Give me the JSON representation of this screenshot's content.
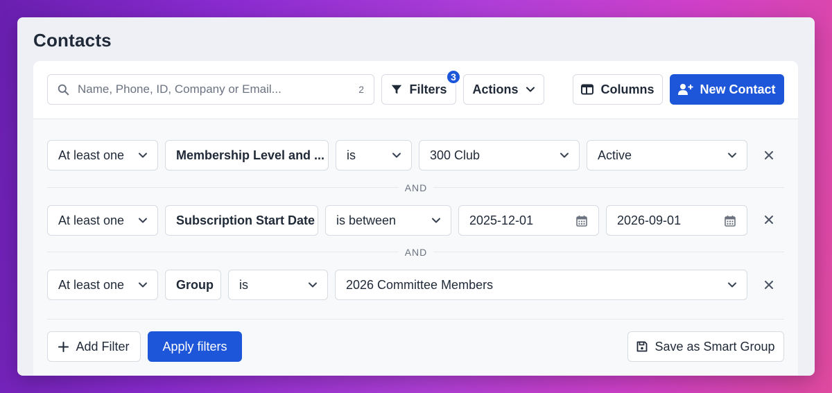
{
  "page": {
    "title": "Contacts"
  },
  "toolbar": {
    "search_placeholder": "Name, Phone, ID, Company or Email...",
    "search_shortcut": "2",
    "filters_label": "Filters",
    "filters_count": "3",
    "actions_label": "Actions",
    "columns_label": "Columns",
    "new_contact_label": "New Contact"
  },
  "filters": [
    {
      "quantifier": "At least one",
      "field": "Membership Level and ...",
      "operator": "is",
      "value1": "300 Club",
      "value2": "Active"
    },
    {
      "quantifier": "At least one",
      "field": "Subscription Start Date",
      "operator": "is between",
      "value1": "2025-12-01",
      "value2": "2026-09-01"
    },
    {
      "quantifier": "At least one",
      "field": "Group",
      "operator": "is",
      "value1": "2026 Committee Members"
    }
  ],
  "connector_label": "AND",
  "footer": {
    "add_filter_label": "Add Filter",
    "apply_label": "Apply filters",
    "save_group_label": "Save as Smart Group"
  },
  "colors": {
    "primary": "#1d56d8",
    "window_bg": "#eef0f6",
    "panel_bg": "#f8f9fb"
  },
  "icons": [
    "search-icon",
    "filter-icon",
    "chevron-down-icon",
    "columns-icon",
    "add-user-icon",
    "calendar-icon",
    "close-icon",
    "plus-icon",
    "save-icon"
  ]
}
